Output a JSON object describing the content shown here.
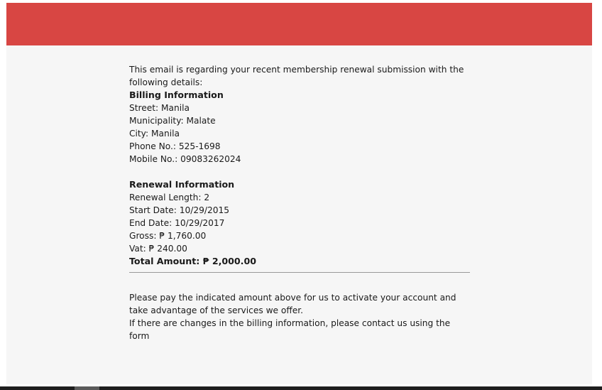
{
  "email": {
    "intro": "This email is regarding your recent membership renewal submission with the following details:",
    "billing": {
      "title": "Billing Information",
      "street": "Street: Manila",
      "municipality": "Municipality: Malate",
      "city": "City: Manila",
      "phone": "Phone No.: 525-1698",
      "mobile": "Mobile No.: 09083262024"
    },
    "renewal": {
      "title": "Renewal Information",
      "length": "Renewal Length: 2",
      "start_date": "Start Date: 10/29/2015",
      "end_date": "End Date: 10/29/2017",
      "gross": "Gross: ₱ 1,760.00",
      "vat": "Vat: ₱ 240.00",
      "total": "Total Amount: ₱ 2,000.00"
    },
    "pay_notice": "Please pay the indicated amount above for us to activate your account and take advantage of the services we offer.",
    "changes_notice": "If there are changes in the billing information, please contact us using the form"
  },
  "colors": {
    "header": "#d84643",
    "background": "#f6f6f6"
  }
}
